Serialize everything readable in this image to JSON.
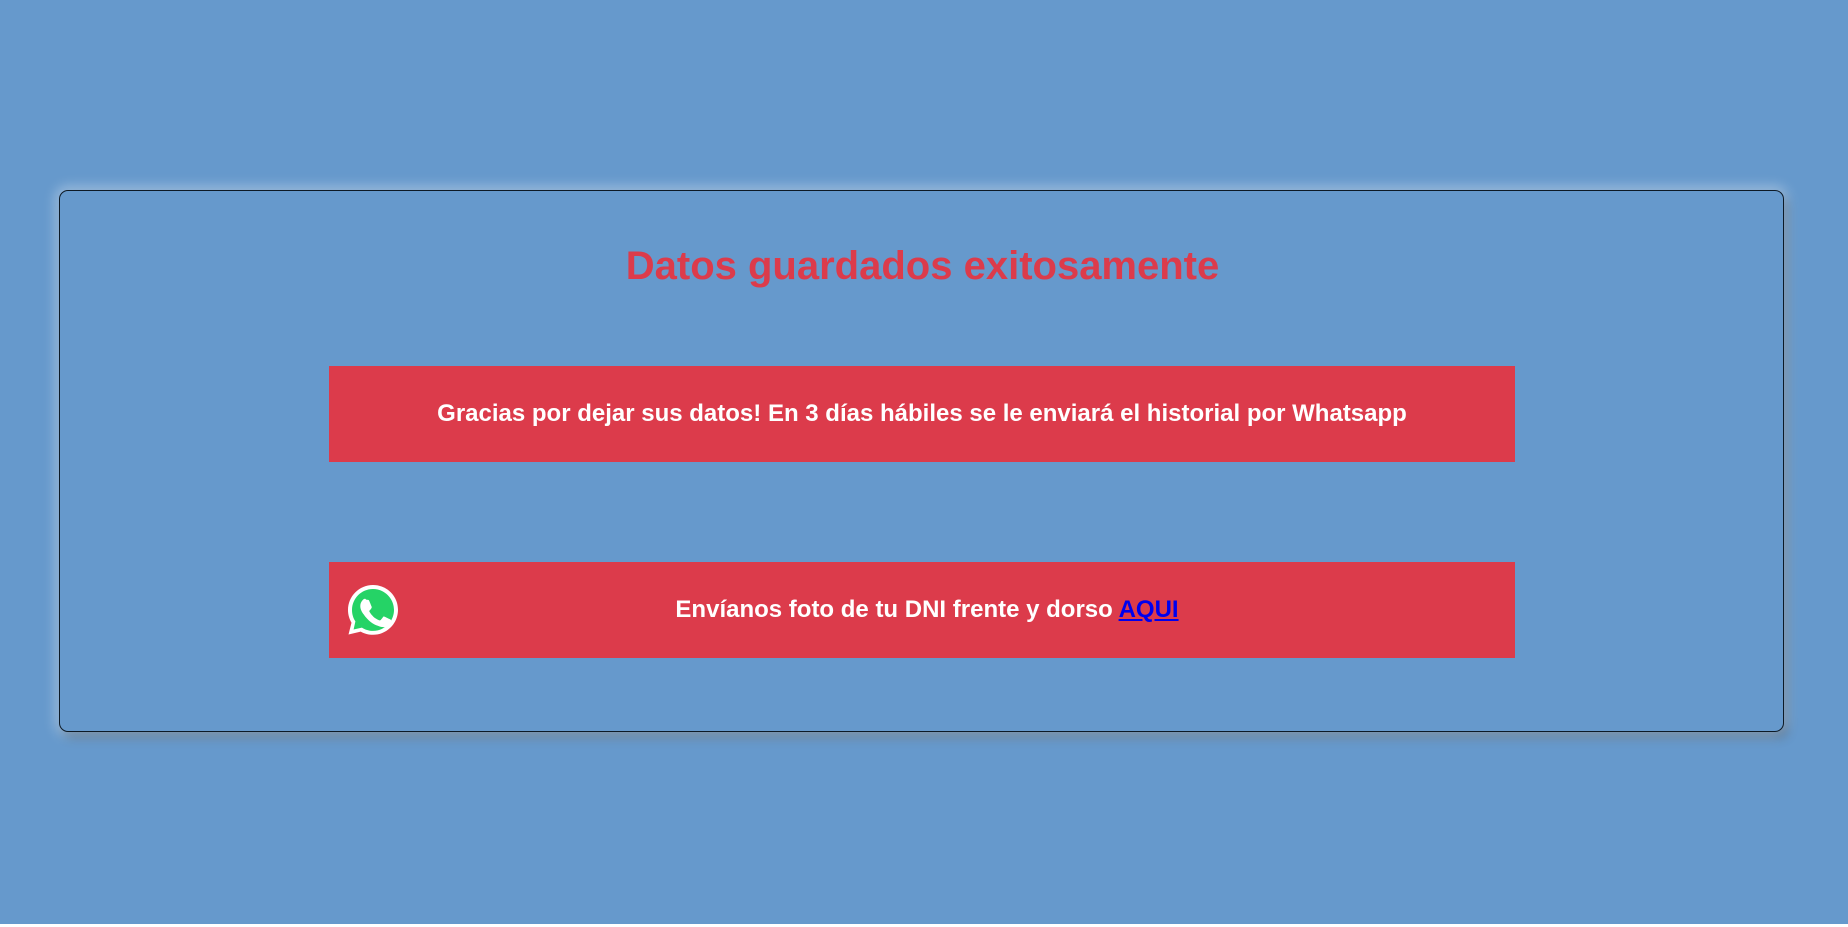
{
  "page": {
    "title": "Datos guardados exitosamente"
  },
  "thanks": {
    "message": "Gracias por dejar sus datos! En 3 días hábiles se le enviará el historial por Whatsapp"
  },
  "dni": {
    "text": "Envíanos foto de tu DNI frente y dorso",
    "link_label": "AQUI",
    "icon": "whatsapp-icon"
  },
  "colors": {
    "background": "#6699cc",
    "accent": "#dc3b4b",
    "text_on_accent": "#ffffff",
    "link": "#0000ee",
    "whatsapp_green": "#25d366"
  }
}
